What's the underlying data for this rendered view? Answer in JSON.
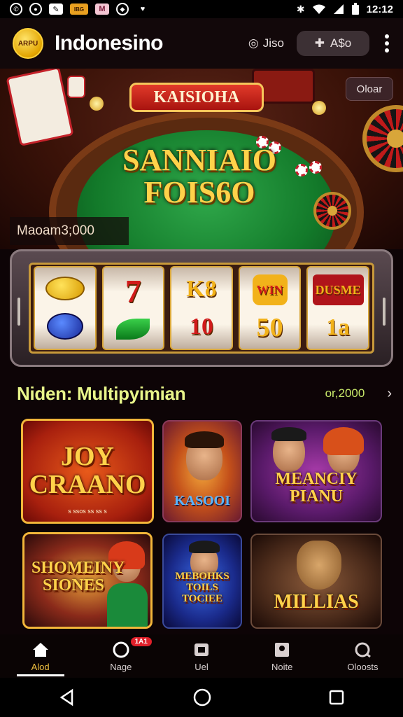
{
  "status_bar": {
    "time": "12:12",
    "left_icons": [
      "whatsapp-icon",
      "record-icon",
      "screenshot-icon",
      "app-icon-orange",
      "app-icon-pink",
      "shield-icon",
      "heart-icon"
    ],
    "left_texts": [
      "IBG",
      "M"
    ],
    "right_icons": [
      "bluetooth-icon",
      "wifi-icon",
      "signal-icon",
      "battery-icon"
    ]
  },
  "header": {
    "logo_text": "ARPU",
    "title": "Indonesino",
    "link_label": "Jiso",
    "pill_label": "A$o"
  },
  "hero": {
    "brand": "KAISIOHA",
    "title_line1": "SANNIAIO",
    "title_line2": "FOIS6O",
    "button_label": "Oloar",
    "stat_text": "Maoam3;000"
  },
  "slot_reels": [
    [
      "lemon",
      "plum"
    ],
    [
      "7",
      "leaf"
    ],
    [
      "K8",
      "10"
    ],
    [
      "WIN",
      "50"
    ],
    [
      "DUSME",
      "1a"
    ]
  ],
  "section": {
    "title": "Niden: Multipyimian",
    "count": "or,2000",
    "chevron": "›"
  },
  "games": [
    {
      "title": "JOY CRAANO",
      "caption": "s ssos ss ss s"
    },
    {
      "title": "KASOOI"
    },
    {
      "title": "MEANCIY PIANU"
    },
    {
      "title": "SHOMEINY SIONES"
    },
    {
      "title": "MEBOHKS TOILS TOCIEE"
    },
    {
      "title": "MILLIAS"
    }
  ],
  "bottom_nav": [
    {
      "label": "Alod",
      "icon": "home-icon",
      "active": true
    },
    {
      "label": "Nage",
      "icon": "chat-icon",
      "badge": "1A1"
    },
    {
      "label": "Uel",
      "icon": "wallet-icon"
    },
    {
      "label": "Noite",
      "icon": "box-icon"
    },
    {
      "label": "Oloosts",
      "icon": "refresh-icon"
    }
  ],
  "colors": {
    "accent": "#f0c040",
    "section_title": "#e8f58a",
    "badge": "#e0202a"
  }
}
